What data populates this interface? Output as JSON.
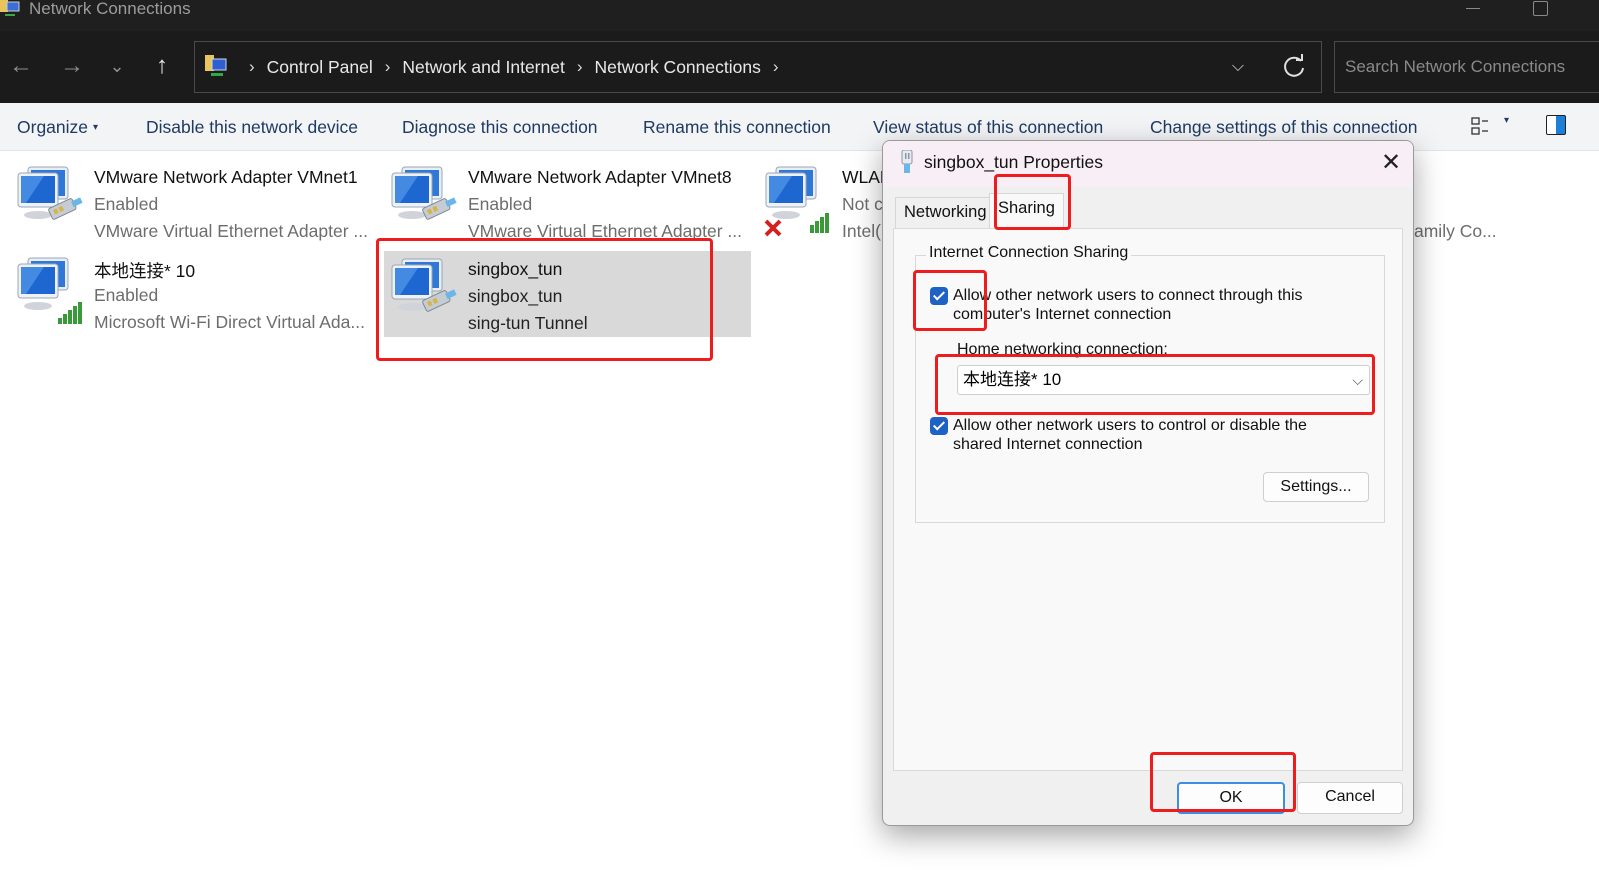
{
  "window": {
    "title": "Network Connections",
    "icon": "network-connections-icon"
  },
  "nav": {
    "back": "←",
    "forward": "→",
    "recent": "⌄",
    "up": "↑",
    "breadcrumb": [
      "Control Panel",
      "Network and Internet",
      "Network Connections"
    ],
    "separator": "›",
    "dropdown_glyph": "⌵",
    "search_placeholder": "Search Network Connections"
  },
  "commands": {
    "organize": "Organize",
    "organize_caret": "▾",
    "items": [
      "Disable this network device",
      "Diagnose this connection",
      "Rename this connection",
      "View status of this connection",
      "Change settings of this connection"
    ],
    "view_caret": "▾"
  },
  "connections": [
    {
      "name": "VMware Network Adapter VMnet1",
      "status": "Enabled",
      "device": "VMware Virtual Ethernet Adapter ...",
      "icon": "ethernet-adapter-icon",
      "selected": false
    },
    {
      "name": "VMware Network Adapter VMnet8",
      "status": "Enabled",
      "device": "VMware Virtual Ethernet Adapter ...",
      "icon": "ethernet-adapter-icon",
      "selected": false
    },
    {
      "name": "WLAN",
      "status": "Not c",
      "device": "Intel(",
      "icon": "wifi-adapter-disconnected-icon",
      "selected": false,
      "partial_suffix": "amily Co..."
    },
    {
      "name": "本地连接* 10",
      "status": "Enabled",
      "device": "Microsoft Wi-Fi Direct Virtual Ada...",
      "icon": "wifi-adapter-icon",
      "selected": false
    },
    {
      "name": "singbox_tun",
      "status": "singbox_tun",
      "device": "sing-tun Tunnel",
      "icon": "ethernet-adapter-icon",
      "selected": true
    }
  ],
  "dialog": {
    "title": "singbox_tun Properties",
    "close": "✕",
    "tabs": [
      {
        "label": "Networking",
        "active": false
      },
      {
        "label": "Sharing",
        "active": true
      }
    ],
    "group_title": "Internet Connection Sharing",
    "allow_connect": {
      "checked": true,
      "line1": "Allow other network users to connect through this",
      "line2": "computer's Internet connection"
    },
    "home_label": "Home networking connection:",
    "home_value": "本地连接* 10",
    "select_chevron": "⌵",
    "allow_control": {
      "checked": true,
      "line1": "Allow other network users to control or disable the",
      "line2": "shared Internet connection"
    },
    "settings_button": "Settings...",
    "ok_button": "OK",
    "cancel_button": "Cancel"
  },
  "colors": {
    "annotation": "#ee1c1c",
    "checkbox": "#1f62c6",
    "titlebar": "#1f1f1f",
    "dialog_title_bg": "#f8eef6",
    "selection": "#d9d9d9"
  }
}
